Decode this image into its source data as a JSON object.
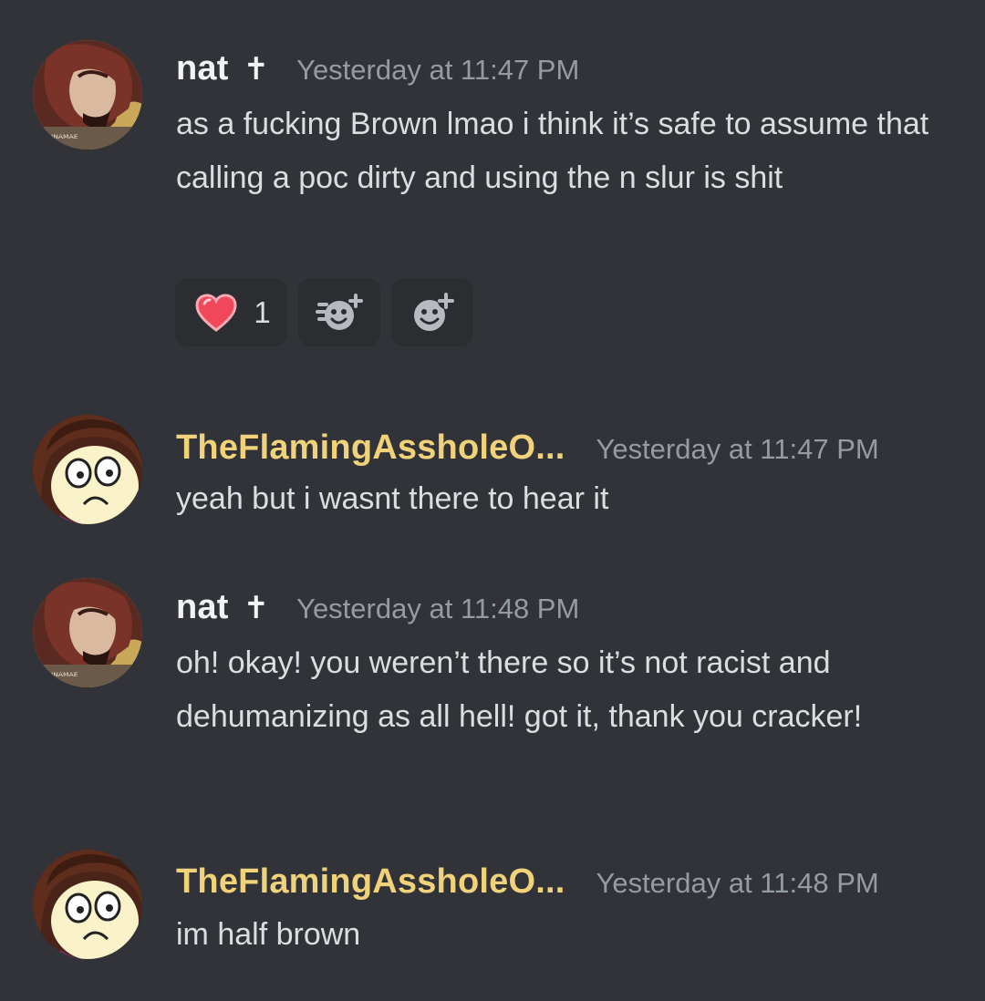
{
  "messages": [
    {
      "username": "nat",
      "badge": "✝",
      "timestamp": "Yesterday at 11:47 PM",
      "text": "as a fucking Brown lmao i think it’s safe to assume that calling a poc dirty and using the n slur is shit",
      "reactions": [
        {
          "icon": "heart-icon",
          "count": "1"
        },
        {
          "icon": "add-super-reaction-icon"
        },
        {
          "icon": "add-reaction-icon"
        }
      ]
    },
    {
      "username": "TheFlamingAssholeO...",
      "timestamp": "Yesterday at 11:47 PM",
      "text": "yeah but i wasnt there to hear it"
    },
    {
      "username": "nat",
      "badge": "✝",
      "timestamp": "Yesterday at 11:48 PM",
      "text": "oh! okay! you weren’t there so it’s not racist and dehumanizing as all hell! got it, thank you cracker!"
    },
    {
      "username": "TheFlamingAssholeO...",
      "timestamp": "Yesterday at 11:48 PM",
      "text": "im half brown"
    }
  ],
  "colors": {
    "background": "#313338",
    "username_default": "#f2f3f5",
    "username_gold": "#f0d27a",
    "timestamp": "#949ba4",
    "message_text": "#dbdee1",
    "reaction_bg": "#2b2d31",
    "heart": "#f0475a"
  }
}
